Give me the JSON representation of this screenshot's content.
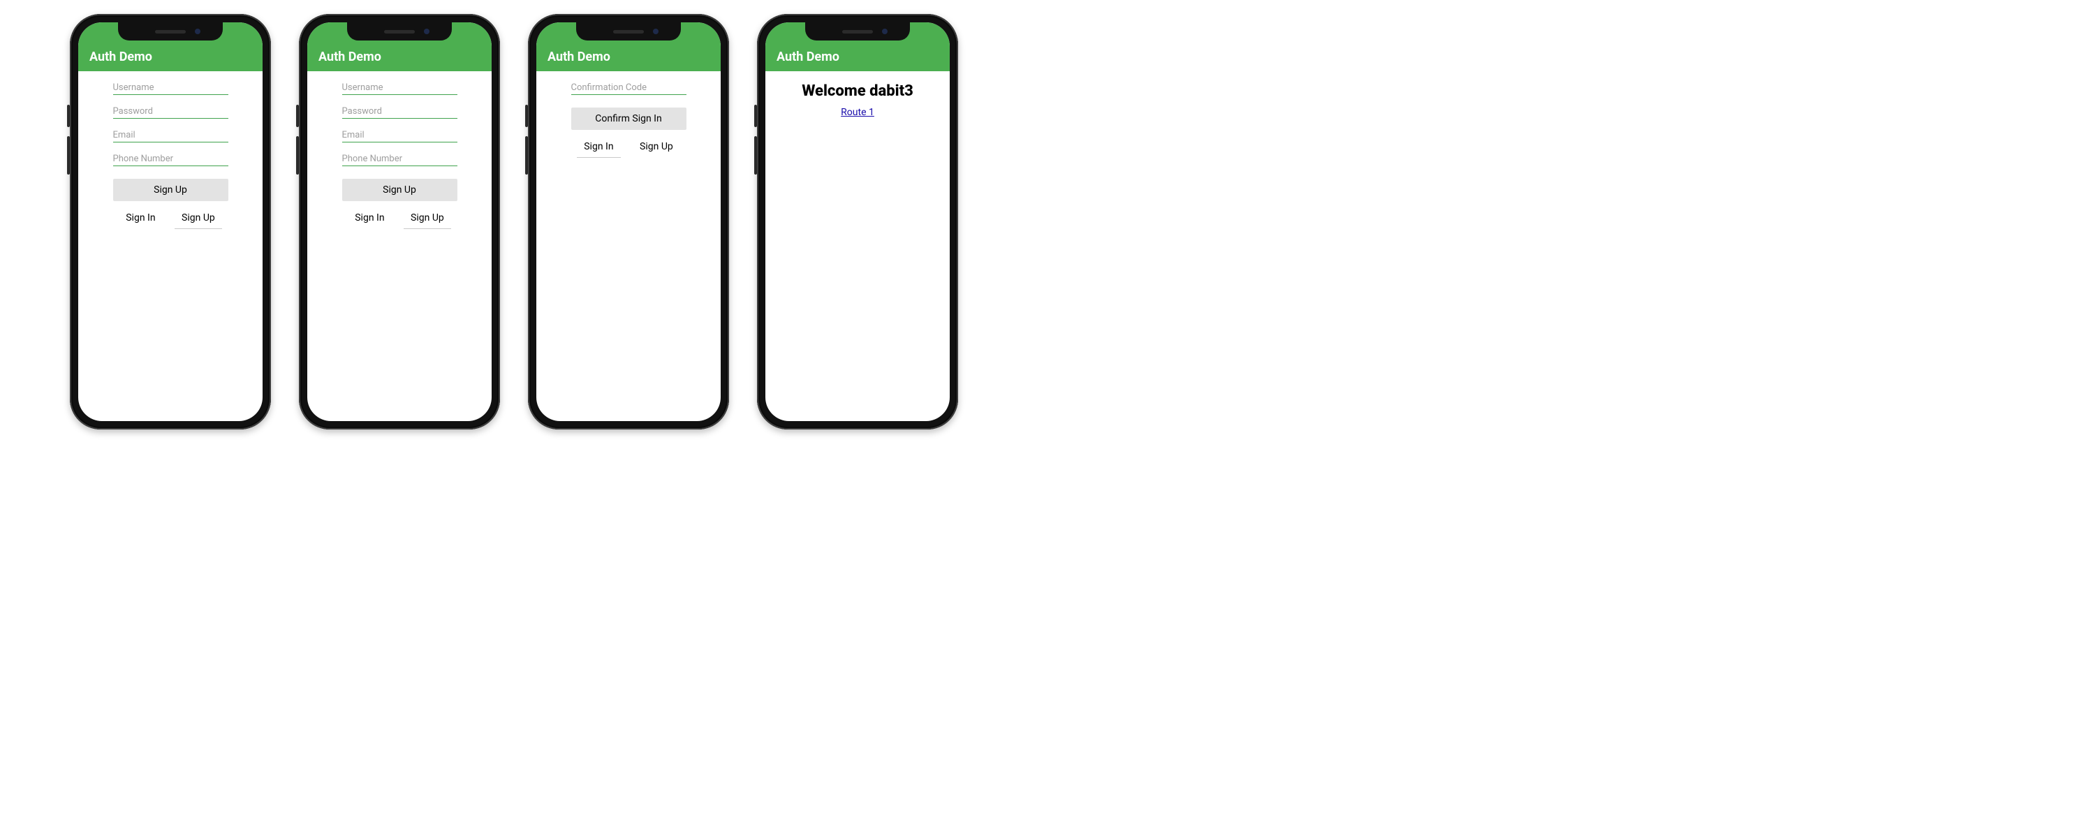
{
  "app_title": "Auth Demo",
  "colors": {
    "brand": "#4CAF50",
    "button_bg": "#e3e3e3",
    "input_underline": "#3fa34d"
  },
  "screens": {
    "signup_a": {
      "fields": {
        "username": {
          "placeholder": "Username",
          "value": ""
        },
        "password": {
          "placeholder": "Password",
          "value": ""
        },
        "email": {
          "placeholder": "Email",
          "value": ""
        },
        "phone": {
          "placeholder": "Phone Number",
          "value": ""
        }
      },
      "primary_button": "Sign Up",
      "tabs": {
        "signin": "Sign In",
        "signup": "Sign Up",
        "active": "signup"
      }
    },
    "signup_b": {
      "fields": {
        "username": {
          "placeholder": "Username",
          "value": ""
        },
        "password": {
          "placeholder": "Password",
          "value": ""
        },
        "email": {
          "placeholder": "Email",
          "value": ""
        },
        "phone": {
          "placeholder": "Phone Number",
          "value": ""
        }
      },
      "primary_button": "Sign Up",
      "tabs": {
        "signin": "Sign In",
        "signup": "Sign Up",
        "active": "signup"
      }
    },
    "confirm": {
      "field": {
        "placeholder": "Confirmation Code",
        "value": ""
      },
      "primary_button": "Confirm Sign In",
      "tabs": {
        "signin": "Sign In",
        "signup": "Sign Up",
        "active": "signin"
      }
    },
    "home": {
      "heading": "Welcome dabit3",
      "link_label": "Route 1"
    }
  }
}
